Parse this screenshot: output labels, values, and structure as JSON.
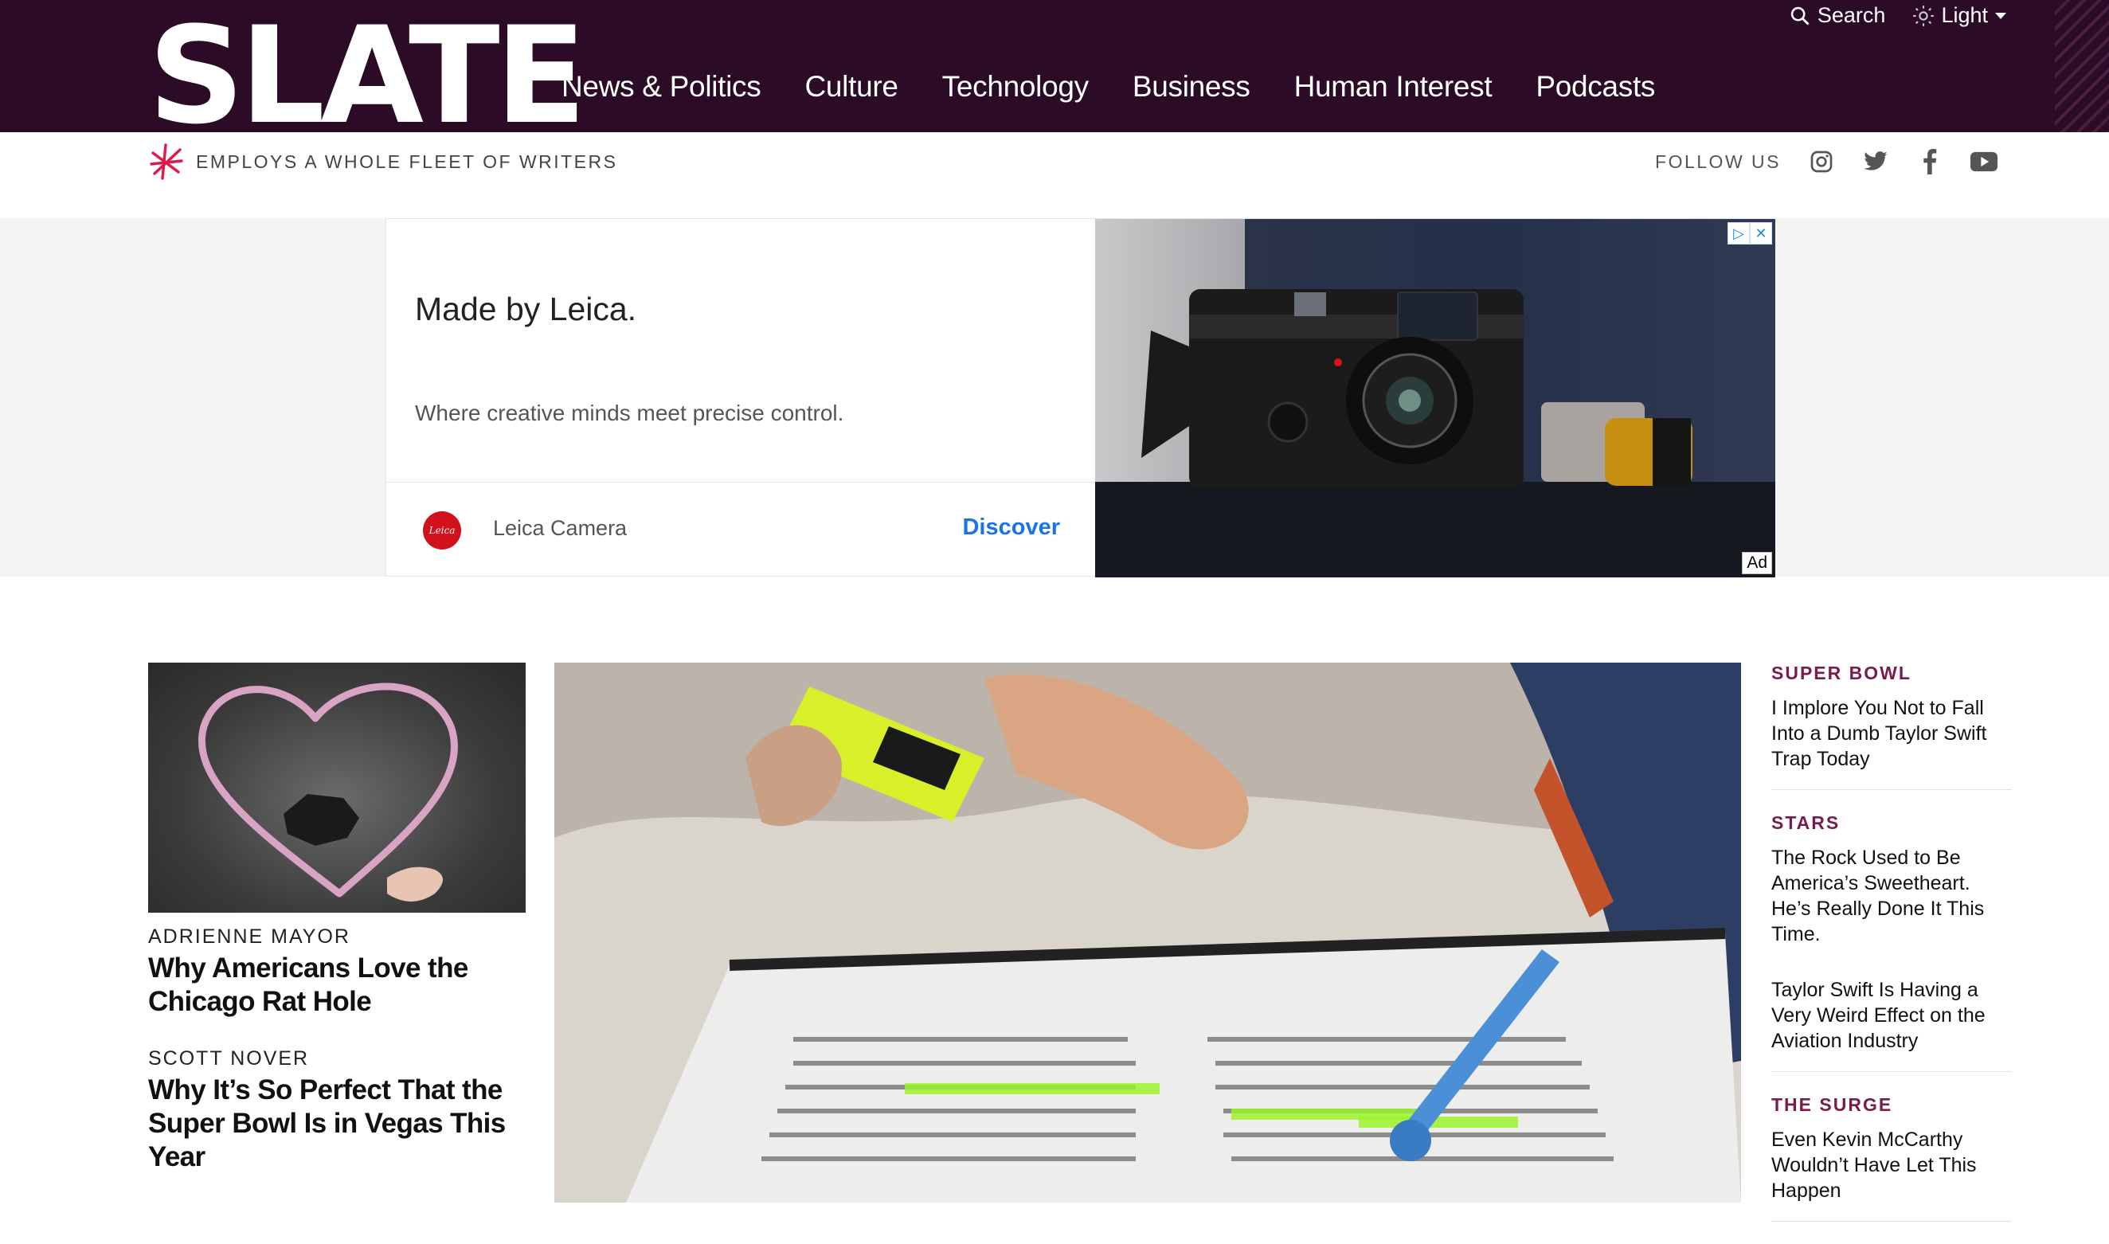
{
  "header": {
    "logo_text": "SLATE",
    "nav": [
      "News & Politics",
      "Culture",
      "Technology",
      "Business",
      "Human Interest",
      "Podcasts"
    ],
    "search_label": "Search",
    "theme_label": "Light"
  },
  "subheader": {
    "tagline": "EMPLOYS A WHOLE FLEET OF WRITERS",
    "follow_label": "FOLLOW US",
    "social": [
      "instagram-icon",
      "twitter-icon",
      "facebook-icon",
      "youtube-icon"
    ]
  },
  "ad": {
    "title": "Made by Leica.",
    "description": "Where creative minds meet precise control.",
    "brand": "Leica Camera",
    "brand_logo_text": "Leica",
    "cta": "Discover",
    "label": "Ad"
  },
  "left": {
    "stories": [
      {
        "author": "ADRIENNE MAYOR",
        "headline": "Why Americans Love the Chicago Rat Hole"
      },
      {
        "author": "SCOTT NOVER",
        "headline": "Why It’s So Perfect That the Super Bowl Is in Vegas This Year"
      }
    ]
  },
  "right": {
    "blocks": [
      {
        "kicker": "SUPER BOWL",
        "headlines": [
          "I Implore You Not to Fall Into a Dumb Taylor Swift Trap Today"
        ]
      },
      {
        "kicker": "STARS",
        "headlines": [
          "The Rock Used to Be America’s Sweetheart. He’s Really Done It This Time.",
          "Taylor Swift Is Having a Very Weird Effect on the Aviation Industry"
        ]
      },
      {
        "kicker": "THE SURGE",
        "headlines": [
          "Even Kevin McCarthy Wouldn’t Have Let This Happen"
        ]
      }
    ]
  },
  "colors": {
    "header_bg": "#2b0b25",
    "accent": "#7a1b4d",
    "ad_cta": "#1a73e8"
  }
}
